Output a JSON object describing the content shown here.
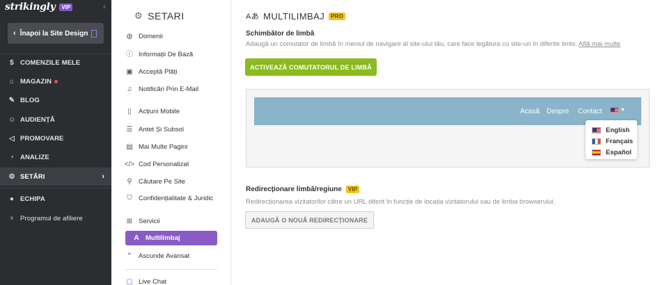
{
  "brand": {
    "logo": "strikingly",
    "vip": "VIP"
  },
  "back_button": "Înapoi la Site Design",
  "left_nav": [
    {
      "label": "COMENZILE MELE",
      "icon": "dollar-circle-icon"
    },
    {
      "label": "MAGAZIN",
      "icon": "store-icon"
    },
    {
      "label": "BLOG",
      "icon": "pen-icon"
    },
    {
      "label": "AUDIENȚĂ",
      "icon": "audience-icon"
    },
    {
      "label": "PROMOVARE",
      "icon": "megaphone-icon"
    },
    {
      "label": "ANALIZE",
      "icon": "analytics-icon"
    },
    {
      "label": "SETĂRI",
      "icon": "gear-icon"
    },
    {
      "label": "ECHIPA",
      "icon": "team-icon"
    },
    {
      "label": "Programul de afiliere",
      "icon": "trophy-icon"
    }
  ],
  "settings": {
    "title": "SETARI",
    "items": [
      {
        "label": "Domenii",
        "icon": "globe-icon"
      },
      {
        "label": "Informații De Bază",
        "icon": "info-icon"
      },
      {
        "label": "Acceptă Plăți",
        "icon": "payment-icon"
      },
      {
        "label": "Notificări Prin E-Mail",
        "icon": "bell-icon"
      },
      {
        "label": "Acțiuni Mobile",
        "icon": "mobile-icon"
      },
      {
        "label": "Antet Și Subsol",
        "icon": "header-footer-icon"
      },
      {
        "label": "Mai Multe Pagini",
        "icon": "pages-icon"
      },
      {
        "label": "Cod Personalizat",
        "icon": "code-icon"
      },
      {
        "label": "Căutare Pe Site",
        "icon": "search-icon"
      },
      {
        "label": "Confidențialitate & Juridic",
        "icon": "shield-icon"
      },
      {
        "label": "Servicii",
        "icon": "grid-icon"
      },
      {
        "label": "Multilimbaj",
        "icon": "translate-icon"
      },
      {
        "label": "Ascunde Avansat",
        "icon": "chevron-up-icon"
      },
      {
        "label": "Live Chat",
        "icon": "chat-icon"
      }
    ]
  },
  "main": {
    "title": "MULTILIMBAJ",
    "pro_badge": "PRO",
    "switcher": {
      "heading": "Schimbător de limbă",
      "description": "Adaugă un comutator de limbă în meniul de navigare al site-ului tău, care face legătura cu site-uri în diferite limbi.",
      "link": "Află mai multe",
      "button": "ACTIVEAZĂ COMUTATORUL DE LIMBĂ"
    },
    "preview": {
      "links": [
        "Acasă",
        "Despre",
        "Contact"
      ],
      "languages": [
        {
          "label": "English",
          "flag": "us"
        },
        {
          "label": "Français",
          "flag": "fr"
        },
        {
          "label": "Español",
          "flag": "es"
        }
      ]
    },
    "redirect": {
      "heading": "Redirecționare limbă/regiune",
      "vip_badge": "VIP",
      "description": "Redirecționarea vizitatorilor către un URL diferit în funcție de locația vizitatorului sau de limba browserului.",
      "button": "ADAUGĂ O NOUĂ REDIRECȚIONARE"
    }
  },
  "colors": {
    "sidebar_bg": "#2b2d31",
    "accent_purple": "#8a5bc7",
    "primary_green": "#8bbb1f",
    "badge_yellow": "#f3c51c",
    "preview_bar": "#8ab4ca"
  }
}
